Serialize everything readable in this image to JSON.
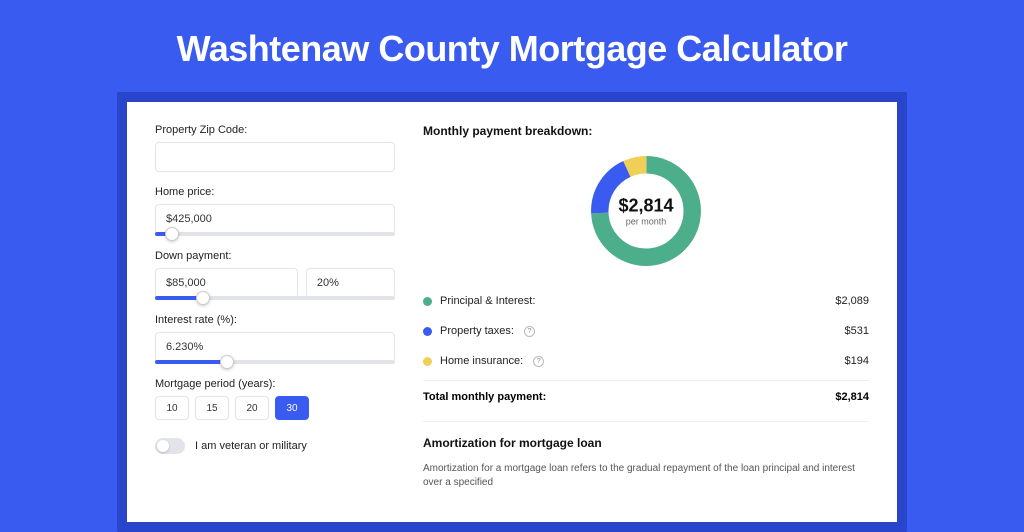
{
  "title": "Washtenaw County Mortgage Calculator",
  "form": {
    "zip_label": "Property Zip Code:",
    "zip_value": "",
    "home_price_label": "Home price:",
    "home_price_value": "$425,000",
    "home_price_slider_pct": 7,
    "down_payment_label": "Down payment:",
    "down_payment_value": "$85,000",
    "down_payment_pct_value": "20%",
    "down_payment_slider_pct": 20,
    "interest_label": "Interest rate (%):",
    "interest_value": "6.230%",
    "interest_slider_pct": 30,
    "period_label": "Mortgage period (years):",
    "period_options": [
      "10",
      "15",
      "20",
      "30"
    ],
    "period_selected": "30",
    "veteran_label": "I am veteran or military",
    "veteran_on": false
  },
  "breakdown": {
    "heading": "Monthly payment breakdown:",
    "amount": "$2,814",
    "amount_sub": "per month",
    "items": [
      {
        "label": "Principal & Interest:",
        "value": "$2,089",
        "info": false,
        "color": "green"
      },
      {
        "label": "Property taxes:",
        "value": "$531",
        "info": true,
        "color": "blue"
      },
      {
        "label": "Home insurance:",
        "value": "$194",
        "info": true,
        "color": "yellow"
      }
    ],
    "total_label": "Total monthly payment:",
    "total_value": "$2,814"
  },
  "amortization": {
    "heading": "Amortization for mortgage loan",
    "text": "Amortization for a mortgage loan refers to the gradual repayment of the loan principal and interest over a specified"
  },
  "chart_data": {
    "type": "pie",
    "title": "Monthly payment breakdown",
    "series": [
      {
        "name": "Principal & Interest",
        "value": 2089,
        "color": "#4cae8a"
      },
      {
        "name": "Property taxes",
        "value": 531,
        "color": "#3a5bf0"
      },
      {
        "name": "Home insurance",
        "value": 194,
        "color": "#f0cf58"
      }
    ],
    "total": 2814,
    "unit": "$/month"
  }
}
